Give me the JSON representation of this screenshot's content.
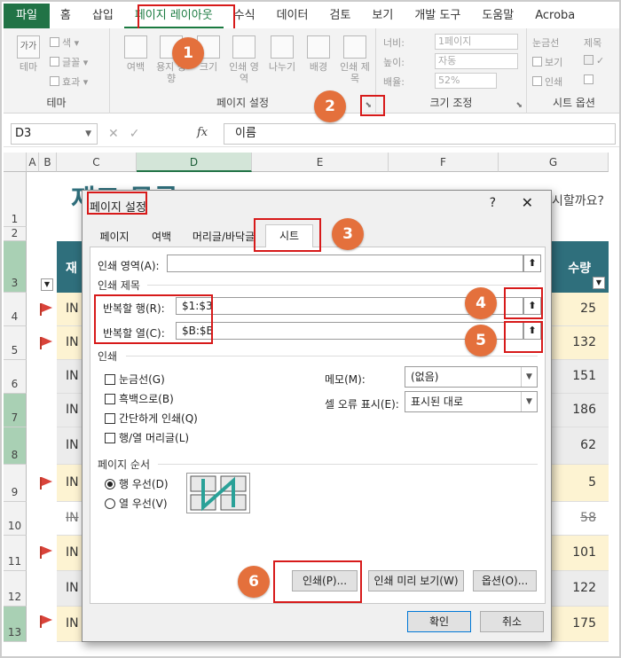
{
  "menu": {
    "file": "파일",
    "tabs": [
      "홈",
      "삽입",
      "페이지 레이아웃",
      "수식",
      "데이터",
      "검토",
      "보기",
      "개발 도구",
      "도움말",
      "Acroba"
    ]
  },
  "ribbon": {
    "theme_group": {
      "title": "테마",
      "theme_btn": "테마",
      "colors": "색",
      "fonts": "글꼴",
      "effects": "효과"
    },
    "page_setup_group": {
      "title": "페이지 설정",
      "margins": "여백",
      "orientation": "용지 방향",
      "size": "크기",
      "print_area": "인쇄 영역",
      "breaks": "나누기",
      "background": "배경",
      "print_titles": "인쇄 제목"
    },
    "scale_group": {
      "title": "크기 조정",
      "width_label": "너비:",
      "width_value": "1페이지",
      "height_label": "높이:",
      "height_value": "자동",
      "scale_label": "배율:",
      "scale_value": "52%"
    },
    "sheet_options_group": {
      "title": "시트 옵션",
      "gridlines": "눈금선",
      "headings": "제목",
      "view": "보기",
      "print": "인쇄"
    }
  },
  "formula_bar": {
    "name_box": "D3",
    "fx": "fx",
    "formula": "이름"
  },
  "sheet": {
    "columns": [
      "A",
      "B",
      "C",
      "D",
      "E",
      "F",
      "G"
    ],
    "heading_partial": "재고 목록",
    "heading_right": "시할까요?",
    "header_left": "재",
    "header_right": "수량",
    "rows": [
      {
        "num": "1",
        "inv": "",
        "qty": ""
      },
      {
        "num": "2",
        "inv": "",
        "qty": ""
      },
      {
        "num": "3",
        "inv": "",
        "qty": ""
      },
      {
        "num": "4",
        "inv": "IN",
        "qty": "25",
        "flag": true
      },
      {
        "num": "5",
        "inv": "IN",
        "qty": "132",
        "flag": true
      },
      {
        "num": "6",
        "inv": "IN",
        "qty": "151"
      },
      {
        "num": "7",
        "inv": "IN",
        "qty": "186"
      },
      {
        "num": "8",
        "inv": "IN",
        "qty": "62"
      },
      {
        "num": "9",
        "inv": "IN",
        "qty": "5",
        "flag": true
      },
      {
        "num": "10",
        "inv": "IN",
        "qty": "58",
        "strike": true
      },
      {
        "num": "11",
        "inv": "IN",
        "qty": "101",
        "flag": true
      },
      {
        "num": "12",
        "inv": "IN",
        "qty": "122"
      },
      {
        "num": "13",
        "inv": "IN",
        "qty": "175",
        "flag": true
      }
    ]
  },
  "dialog": {
    "title": "페이지 설정",
    "help": "?",
    "close": "✕",
    "tabs": [
      "페이지",
      "여백",
      "머리글/바닥글",
      "시트"
    ],
    "print_area_label": "인쇄 영역(A):",
    "print_area_value": "",
    "print_titles_section": "인쇄 제목",
    "rows_repeat_label": "반복할 행(R):",
    "rows_repeat_value": "$1:$3",
    "cols_repeat_label": "반복할 열(C):",
    "cols_repeat_value": "$B:$B",
    "print_section": "인쇄",
    "gridlines": "눈금선(G)",
    "black_white": "흑백으로(B)",
    "draft": "간단하게 인쇄(Q)",
    "row_col_headings": "행/열 머리글(L)",
    "comments_label": "메모(M):",
    "comments_value": "(없음)",
    "errors_label": "셀 오류 표시(E):",
    "errors_value": "표시된 대로",
    "page_order_section": "페이지 순서",
    "down_then_over": "행 우선(D)",
    "over_then_down": "열 우선(V)",
    "print_btn": "인쇄(P)...",
    "preview_btn": "인쇄 미리 보기(W)",
    "options_btn": "옵션(O)...",
    "ok_btn": "확인",
    "cancel_btn": "취소"
  },
  "badges": [
    "1",
    "2",
    "3",
    "4",
    "5",
    "6"
  ],
  "colors": {
    "excel_green": "#217346",
    "badge_orange": "#e4703c",
    "highlight_red": "#d71a1a",
    "teal_header": "#2f6f7c",
    "row_yellow": "#fdf3d2",
    "row_gray": "#ececec"
  }
}
